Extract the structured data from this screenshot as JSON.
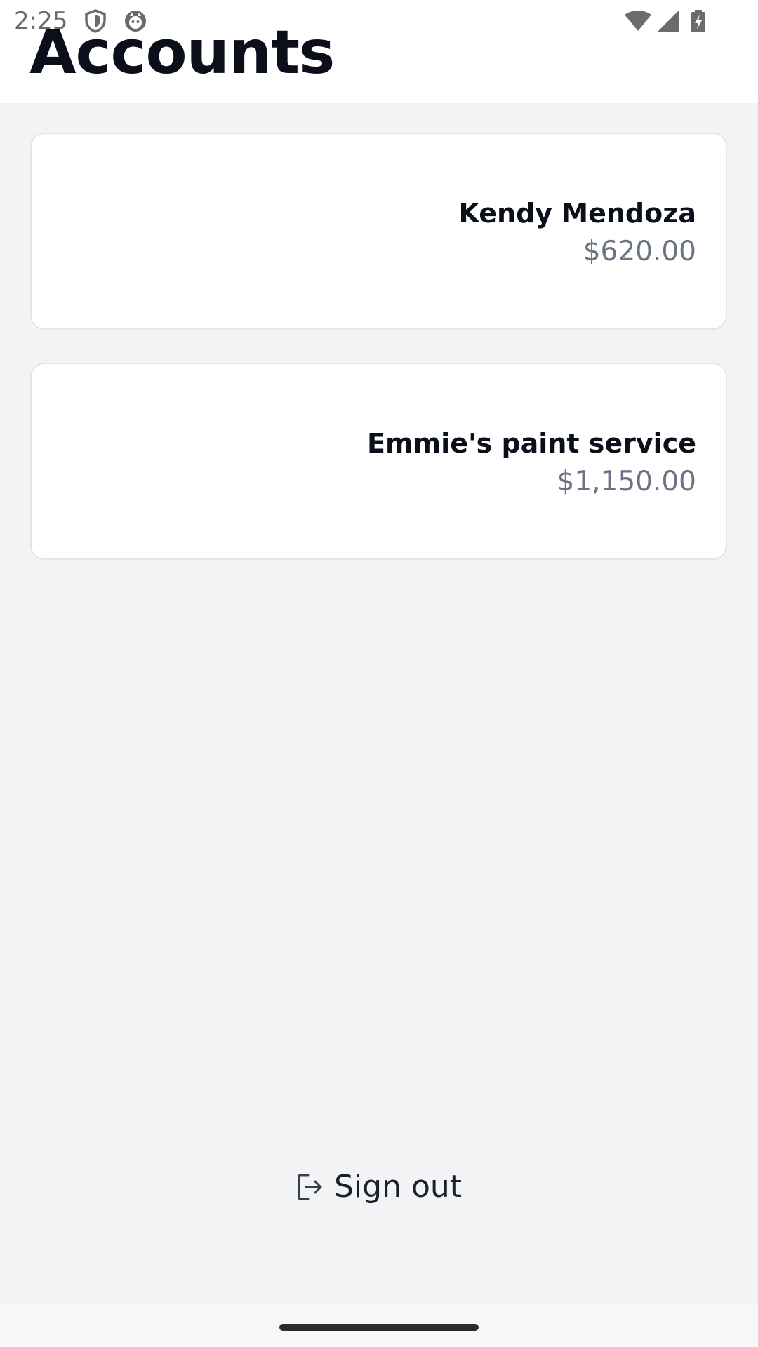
{
  "status_bar": {
    "time": "2:25",
    "icons": [
      "shield-icon",
      "cat-face-icon",
      "wifi-icon",
      "signal-icon",
      "battery-charging-icon"
    ]
  },
  "header": {
    "title": "Accounts"
  },
  "accounts": [
    {
      "name": "Kendy Mendoza",
      "amount": "$620.00"
    },
    {
      "name": "Emmie's paint service",
      "amount": "$1,150.00"
    }
  ],
  "footer": {
    "sign_out_label": "Sign out",
    "sign_out_icon": "sign-out-icon"
  },
  "colors": {
    "background": "#f2f3f5",
    "card": "#ffffff",
    "title": "#0b0f19",
    "amount": "#6b7385"
  }
}
